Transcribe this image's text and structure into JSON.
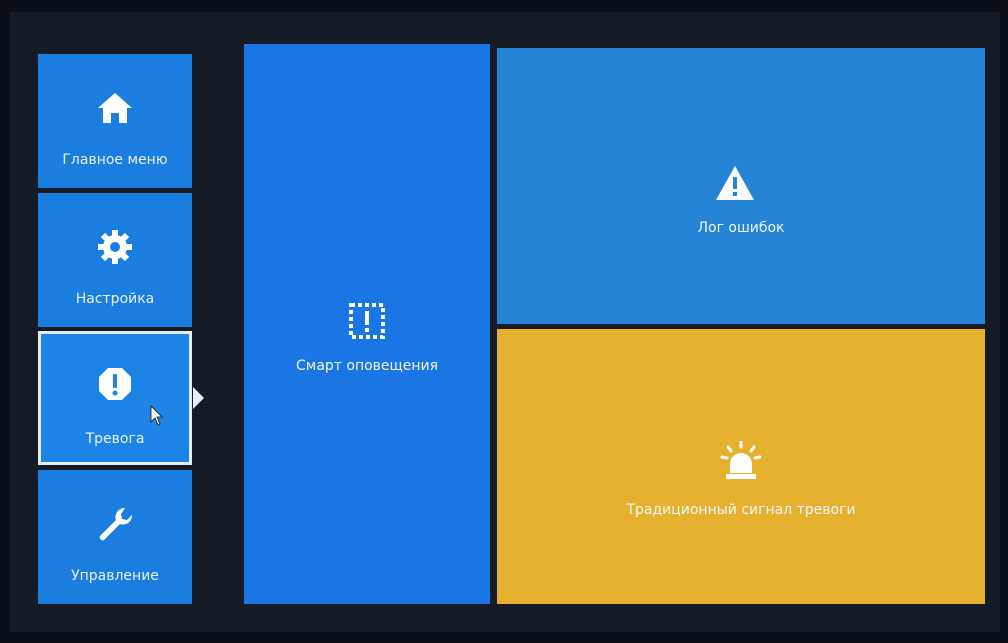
{
  "sidebar": {
    "items": [
      {
        "label": "Главное меню",
        "icon": "home-icon"
      },
      {
        "label": "Настройка",
        "icon": "gear-icon"
      },
      {
        "label": "Тревога",
        "icon": "alarm-octagon-icon",
        "selected": true
      },
      {
        "label": "Управление",
        "icon": "wrench-icon"
      }
    ]
  },
  "tiles": {
    "smart": {
      "label": "Смарт оповещения",
      "icon": "smart-alert-icon"
    },
    "log": {
      "label": "Лог ошибок",
      "icon": "warning-triangle-icon"
    },
    "traditional": {
      "label": "Традиционный сигнал тревоги",
      "icon": "siren-icon"
    }
  },
  "colors": {
    "tile_blue": "#1976e4",
    "tile_light_blue": "#2584d6",
    "tile_yellow": "#e6b12e",
    "sidebar_blue": "#1a7ee0",
    "selected_border": "#e8eef6"
  }
}
